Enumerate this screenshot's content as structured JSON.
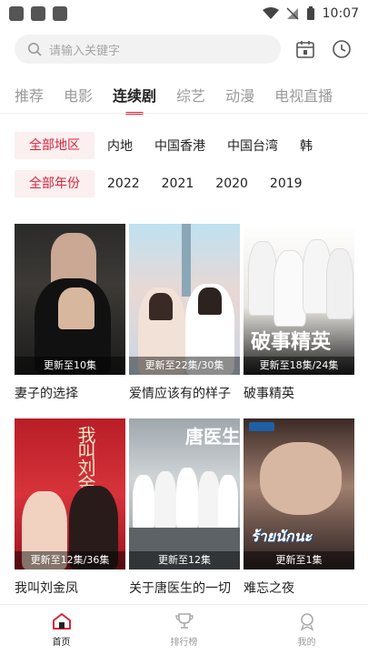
{
  "status_bar": {
    "time": "10:07"
  },
  "search": {
    "placeholder": "请输入关键字"
  },
  "tabs": [
    {
      "label": "推荐"
    },
    {
      "label": "电影"
    },
    {
      "label": "连续剧",
      "active": true
    },
    {
      "label": "综艺"
    },
    {
      "label": "动漫"
    },
    {
      "label": "电视直播"
    }
  ],
  "filters": {
    "region": {
      "selected": "全部地区",
      "options": [
        "内地",
        "中国香港",
        "中国台湾",
        "韩"
      ]
    },
    "year": {
      "selected": "全部年份",
      "options": [
        "2022",
        "2021",
        "2020",
        "2019"
      ]
    }
  },
  "shows": [
    {
      "title": "妻子的选择",
      "badge": "更新至10集"
    },
    {
      "title": "爱情应该有的样子",
      "badge": "更新至22集/30集"
    },
    {
      "title": "破事精英",
      "badge": "更新至18集/24集"
    },
    {
      "title": "我叫刘金凤",
      "badge": "更新至12集/36集"
    },
    {
      "title": "关于唐医生的一切",
      "badge": "更新至12集"
    },
    {
      "title": "难忘之夜",
      "badge": "更新至1集"
    }
  ],
  "posters": {
    "p2_text": "",
    "p3_text": "破事精英",
    "p4_text": "我叫刘金凤",
    "p5_text": "唐医生",
    "p6_text": "ร้ายนักนะ"
  },
  "bottom_nav": [
    {
      "label": "首页",
      "icon": "home-icon",
      "active": true
    },
    {
      "label": "排行榜",
      "icon": "trophy-icon"
    },
    {
      "label": "我的",
      "icon": "profile-icon"
    }
  ],
  "colors": {
    "accent": "#d9253a",
    "chip_bg": "#fbeff0"
  }
}
